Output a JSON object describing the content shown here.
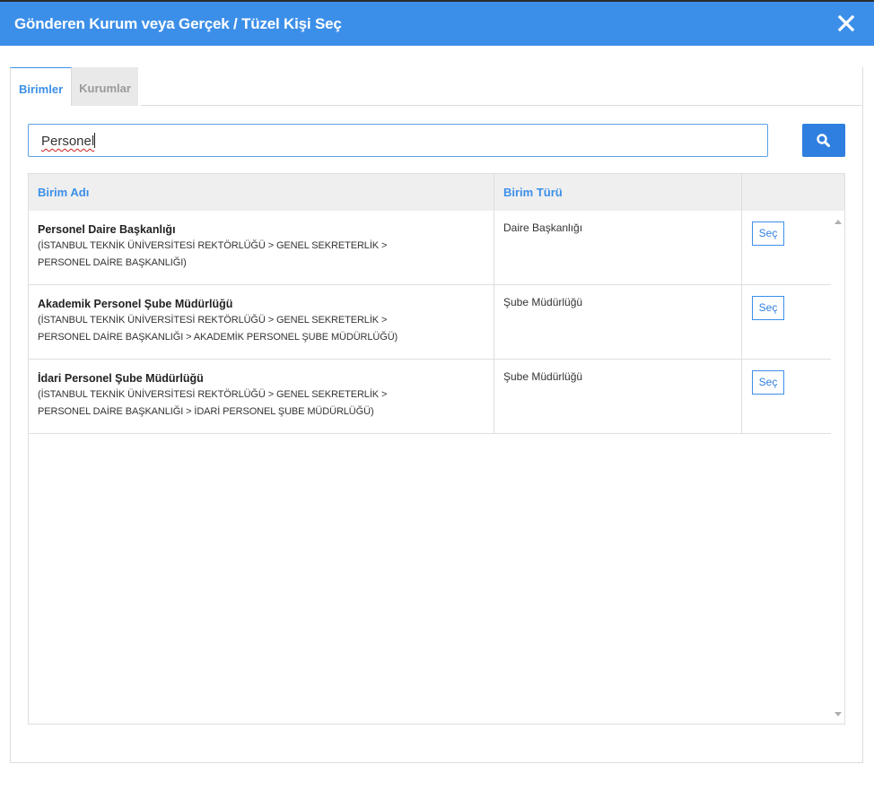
{
  "dialog": {
    "title": "Gönderen Kurum veya Gerçek / Tüzel Kişi Seç",
    "close_icon": "close-icon"
  },
  "tabs": [
    {
      "label": "Birimler",
      "active": true
    },
    {
      "label": "Kurumlar",
      "active": false
    }
  ],
  "search": {
    "value": "Personel",
    "button_icon": "search-icon"
  },
  "table": {
    "columns": [
      "Birim Adı",
      "Birim Türü",
      ""
    ],
    "rows": [
      {
        "name": "Personel Daire Başkanlığı",
        "path_line1": "(İSTANBUL TEKNİK ÜNİVERSİTESİ REKTÖRLÜĞÜ > GENEL SEKRETERLİK >",
        "path_line2": "PERSONEL DAİRE BAŞKANLIĞI)",
        "type": "Daire Başkanlığı",
        "action": "Seç"
      },
      {
        "name": "Akademik Personel Şube Müdürlüğü",
        "path_line1": "(İSTANBUL TEKNİK ÜNİVERSİTESİ REKTÖRLÜĞÜ > GENEL SEKRETERLİK >",
        "path_line2": "PERSONEL DAİRE BAŞKANLIĞI > AKADEMİK PERSONEL ŞUBE MÜDÜRLÜĞÜ)",
        "type": "Şube Müdürlüğü",
        "action": "Seç"
      },
      {
        "name": "İdari Personel Şube Müdürlüğü",
        "path_line1": "(İSTANBUL TEKNİK ÜNİVERSİTESİ REKTÖRLÜĞÜ > GENEL SEKRETERLİK >",
        "path_line2": "PERSONEL DAİRE BAŞKANLIĞI > İDARİ PERSONEL ŞUBE MÜDÜRLÜĞÜ)",
        "type": "Şube Müdürlüğü",
        "action": "Seç"
      }
    ]
  },
  "colors": {
    "accent": "#3c8fe8",
    "button": "#2f7fe0"
  }
}
